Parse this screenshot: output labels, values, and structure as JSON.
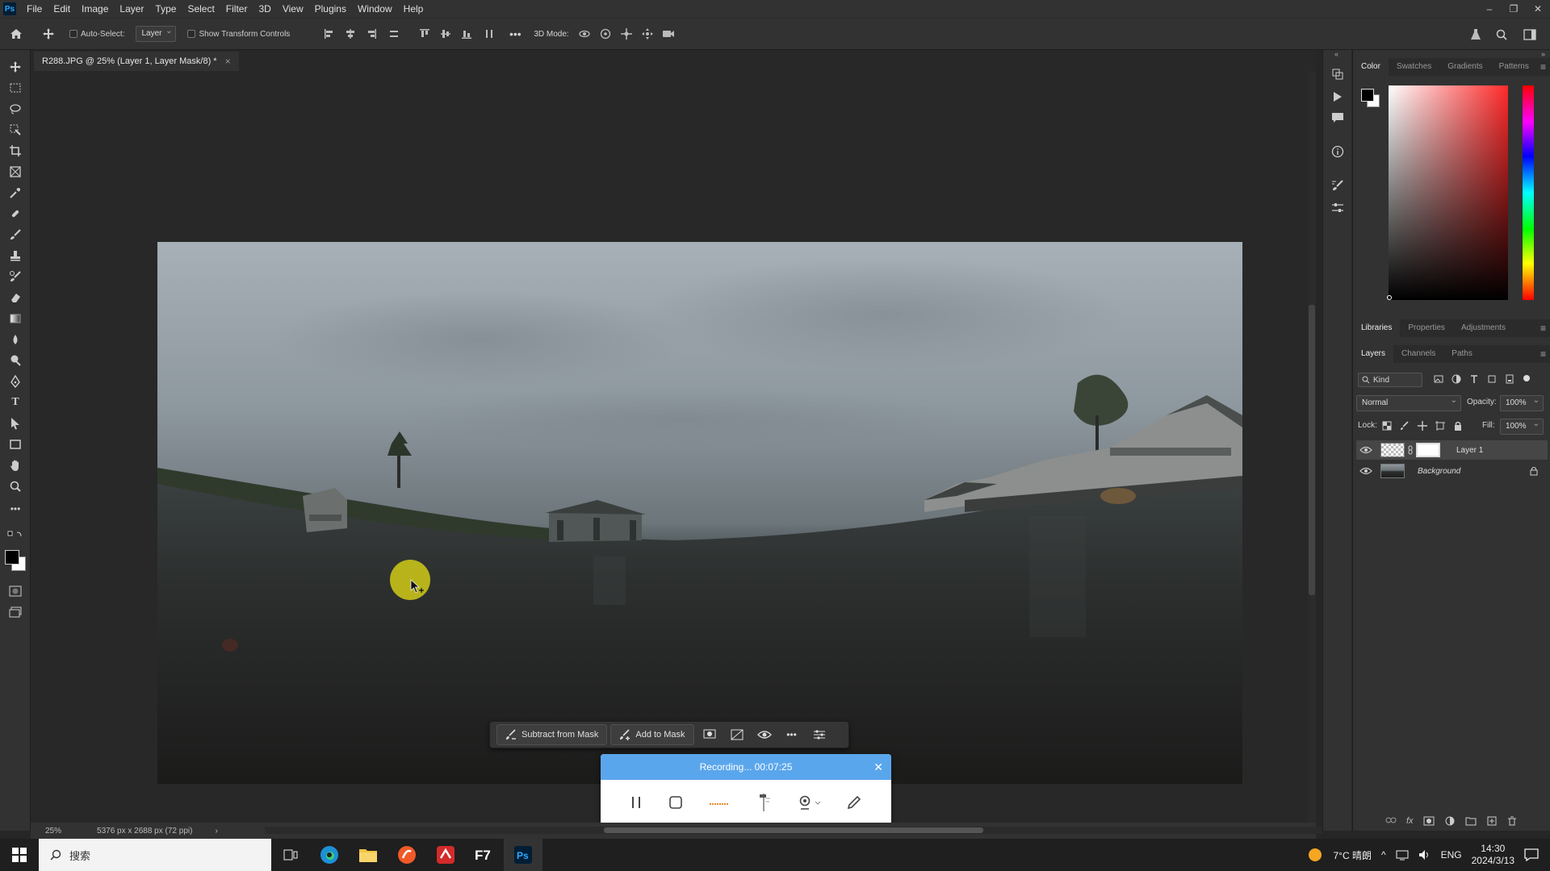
{
  "menubar": {
    "items": [
      "File",
      "Edit",
      "Image",
      "Layer",
      "Type",
      "Select",
      "Filter",
      "3D",
      "View",
      "Plugins",
      "Window",
      "Help"
    ]
  },
  "options": {
    "auto_select_label": "Auto-Select:",
    "auto_select_value": "Layer",
    "show_transform_label": "Show Transform Controls",
    "mode_3d_label": "3D Mode:"
  },
  "document": {
    "tab_title": "R288.JPG @ 25% (Layer 1, Layer Mask/8) *",
    "zoom": "25%",
    "size_info": "5376 px x 2688 px (72 ppi)"
  },
  "context_bar": {
    "subtract_label": "Subtract from Mask",
    "add_label": "Add to Mask"
  },
  "recorder": {
    "status": "Recording... 00:07:25"
  },
  "panels": {
    "color_tabs": [
      "Color",
      "Swatches",
      "Gradients",
      "Patterns"
    ],
    "lib_tabs": [
      "Libraries",
      "Properties",
      "Adjustments"
    ],
    "layer_tabs": [
      "Layers",
      "Channels",
      "Paths"
    ],
    "kind_label": "Kind",
    "blend_mode": "Normal",
    "opacity_label": "Opacity:",
    "opacity_value": "100%",
    "lock_label": "Lock:",
    "fill_label": "Fill:",
    "fill_value": "100%",
    "layers": [
      {
        "name": "Layer 1"
      },
      {
        "name": "Background"
      }
    ]
  },
  "wintaskbar": {
    "search_text": "搜索",
    "weather": "7°C 晴朗",
    "lang": "ENG",
    "time": "14:30",
    "date": "2024/3/13"
  },
  "colors": {
    "accent": "#31a8ff",
    "recorder_header": "#5aa6ec",
    "cursor_highlight": "#c8c21a"
  }
}
